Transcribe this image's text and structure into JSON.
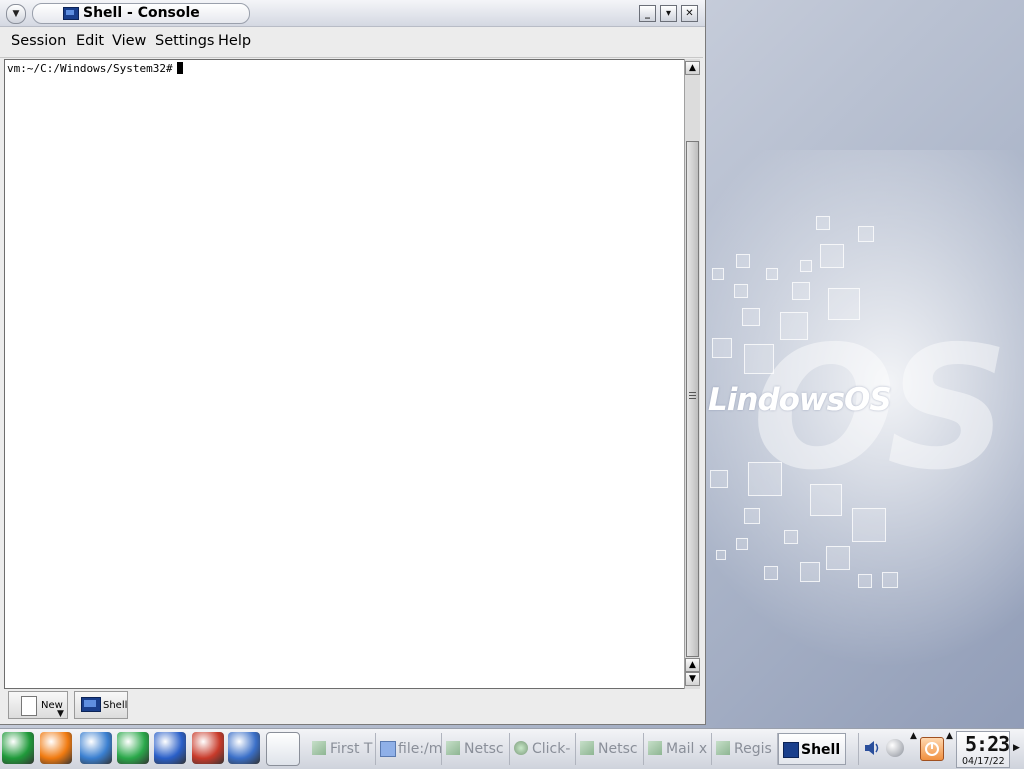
{
  "window": {
    "title": "Shell - Console",
    "menu": [
      "Session",
      "Edit",
      "View",
      "Settings",
      "Help"
    ],
    "controls": {
      "minimize": "minimize-icon",
      "maximize": "maximize-icon",
      "close": "close-icon"
    }
  },
  "terminal": {
    "prompt": "vm:~/C:/Windows/System32#"
  },
  "session_tabs": {
    "new_label": "New",
    "shell_label": "Shell"
  },
  "desktop": {
    "logo_text": "LindowsOS",
    "big_text": "OS"
  },
  "taskbar": {
    "quick_launch": [
      {
        "name": "lindows-launcher-icon",
        "color": "#1f9a3a"
      },
      {
        "name": "life-vest-icon",
        "color": "#f07a10"
      },
      {
        "name": "file-cabinet-icon",
        "color": "#3a7fd0"
      },
      {
        "name": "runner-icon",
        "color": "#2aa84a"
      },
      {
        "name": "globe-icon",
        "color": "#2a5fc8"
      },
      {
        "name": "mailbox-icon",
        "color": "#c83a2a"
      },
      {
        "name": "click-n-run-icon",
        "color": "#3a6fc8"
      },
      {
        "name": "notes-icon",
        "color": "#d0a020"
      }
    ],
    "tasks": [
      {
        "label": "First T",
        "icon": "lindows-icon"
      },
      {
        "label": "file:/m",
        "icon": "folder-icon"
      },
      {
        "label": "Netsc",
        "icon": "lindows-icon"
      },
      {
        "label": "Click-",
        "icon": "globe-icon"
      },
      {
        "label": "Netsc",
        "icon": "lindows-icon"
      },
      {
        "label": "Mail x",
        "icon": "lindows-icon"
      },
      {
        "label": "Regis",
        "icon": "lindows-icon"
      },
      {
        "label": "Shell",
        "icon": "monitor-icon",
        "active": true
      }
    ],
    "clock": {
      "time": "5:23",
      "date": "04/17/22"
    }
  }
}
